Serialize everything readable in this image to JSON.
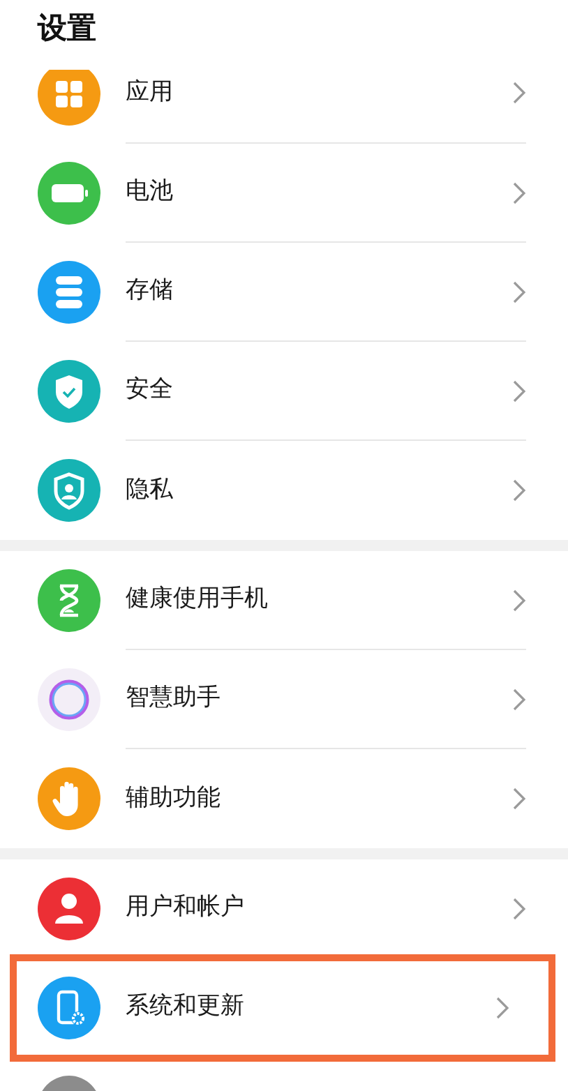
{
  "title": "设置",
  "groups": [
    {
      "items": [
        {
          "kind": "apps",
          "label": "应用",
          "highlighted": false
        },
        {
          "kind": "battery",
          "label": "电池",
          "highlighted": false
        },
        {
          "kind": "storage",
          "label": "存储",
          "highlighted": false
        },
        {
          "kind": "security",
          "label": "安全",
          "highlighted": false
        },
        {
          "kind": "privacy",
          "label": "隐私",
          "highlighted": false
        }
      ]
    },
    {
      "items": [
        {
          "kind": "health",
          "label": "健康使用手机",
          "highlighted": false
        },
        {
          "kind": "assistant",
          "label": "智慧助手",
          "highlighted": false
        },
        {
          "kind": "accessibility",
          "label": "辅助功能",
          "highlighted": false
        }
      ]
    },
    {
      "items": [
        {
          "kind": "user",
          "label": "用户和帐户",
          "highlighted": false
        },
        {
          "kind": "system",
          "label": "系统和更新",
          "highlighted": true
        },
        {
          "kind": "partial"
        }
      ]
    }
  ]
}
